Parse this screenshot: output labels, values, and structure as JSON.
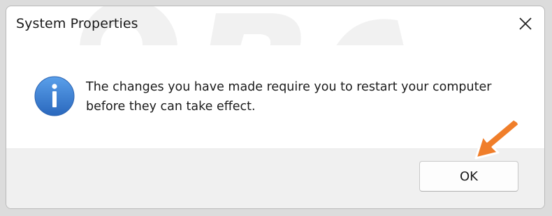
{
  "dialog": {
    "title": "System Properties",
    "message_line1": "The changes you have made require you to restart your computer",
    "message_line2": "before they can take effect.",
    "ok_label": "OK"
  },
  "icons": {
    "close": "close-icon",
    "info": "info-icon",
    "arrow": "arrow-pointer-icon"
  },
  "watermark": {
    "text": "PC risk.com"
  },
  "colors": {
    "info_blue": "#3a7fd1",
    "arrow_orange": "#f07e2a"
  }
}
